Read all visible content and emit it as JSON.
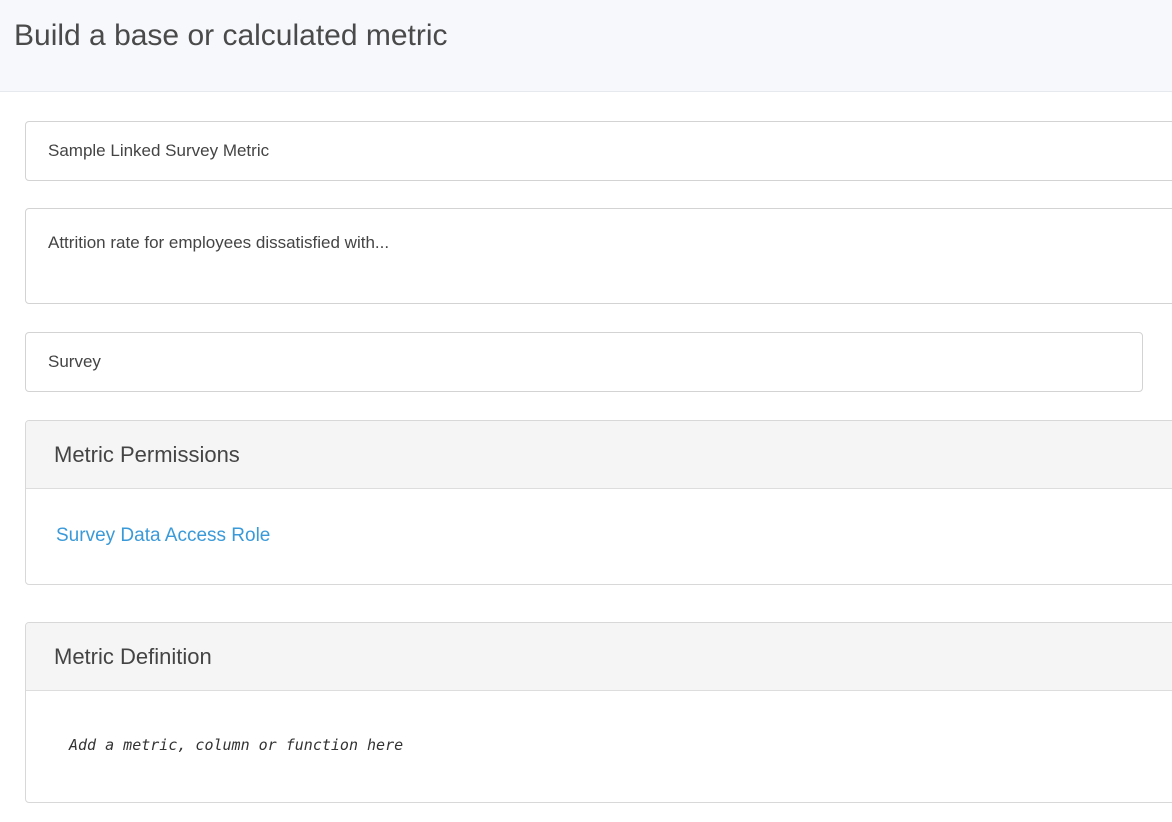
{
  "header": {
    "title": "Build a base or calculated metric"
  },
  "form": {
    "name_value": "Sample Linked Survey Metric",
    "description_value": "Attrition rate for employees dissatisfied with...",
    "category_value": "Survey"
  },
  "permissions": {
    "heading": "Metric Permissions",
    "role_link": "Survey Data Access Role"
  },
  "definition": {
    "heading": "Metric Definition",
    "placeholder": "Add a metric, column or function here"
  },
  "colors": {
    "header_bg": "#f6f8fc",
    "panel_heading_bg": "#f5f5f5",
    "link": "#3a9ad9",
    "border": "#d3d3d3"
  }
}
